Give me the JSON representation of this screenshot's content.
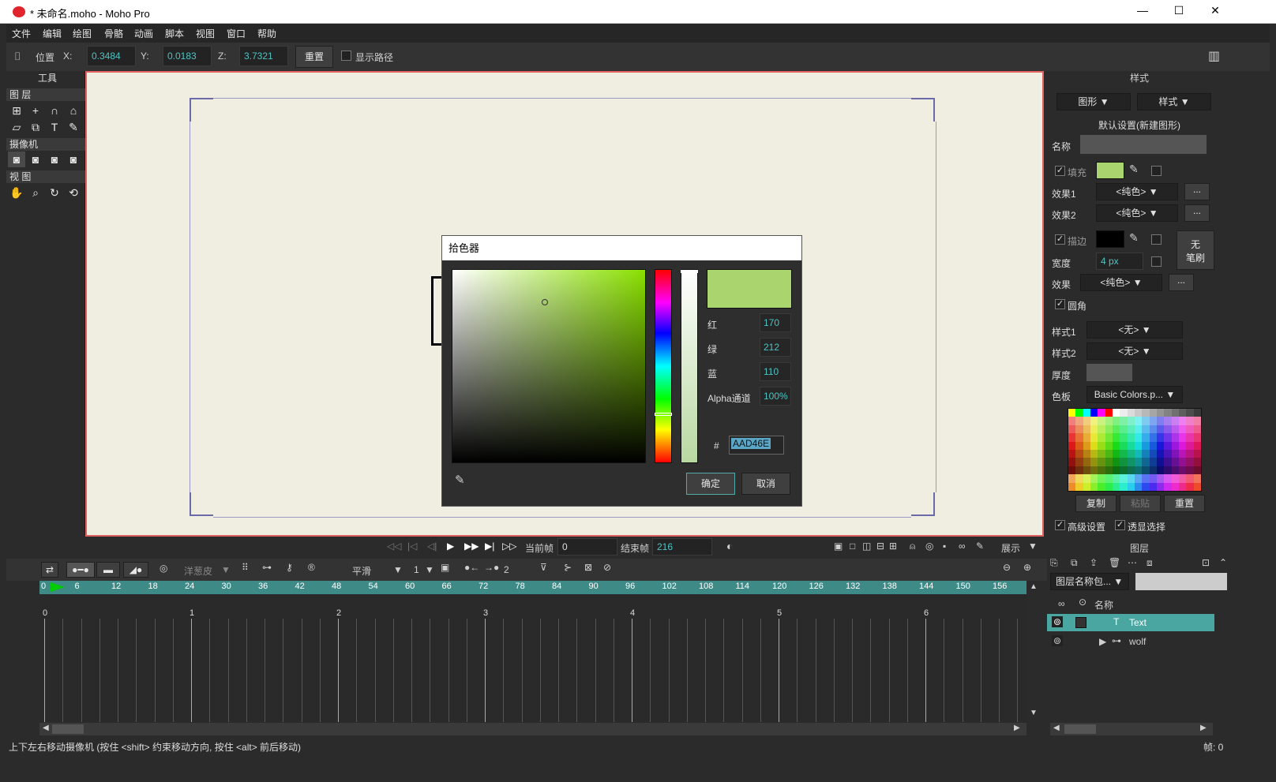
{
  "window": {
    "title": "* 未命名.moho - Moho Pro",
    "min": "—",
    "max": "☐",
    "close": "✕"
  },
  "menu": [
    "文件",
    "编辑",
    "绘图",
    "骨骼",
    "动画",
    "脚本",
    "视图",
    "窗口",
    "帮助"
  ],
  "options": {
    "position_label": "位置",
    "x_label": "X:",
    "x_value": "0.3484",
    "y_label": "Y:",
    "y_value": "0.0183",
    "z_label": "Z:",
    "z_value": "3.7321",
    "reset_label": "重置",
    "show_path_label": "显示路径"
  },
  "tools": {
    "header": "工具",
    "sections": {
      "layer": "图 层",
      "camera": "摄像机",
      "view": "视 图"
    },
    "icons": [
      "rect-select-icon",
      "add-point-icon",
      "curve-icon",
      "transform-icon",
      "shear-icon",
      "copy-icon",
      "text-icon",
      "brush-icon"
    ]
  },
  "color_picker": {
    "title": "拾色器",
    "red_label": "红",
    "red": "170",
    "green_label": "绿",
    "green": "212",
    "blue_label": "蓝",
    "blue": "110",
    "alpha_label": "Alpha通道",
    "alpha": "100%",
    "hash": "#",
    "hex": "AAD46E",
    "ok": "确定",
    "cancel": "取消",
    "color": "#aad46e"
  },
  "style_panel": {
    "header": "样式",
    "dd_shape": "图形",
    "dd_style": "样式",
    "defaults": "默认设置(新建图形)",
    "name_label": "名称",
    "fill_label": "填充",
    "fill_color": "#aad46e",
    "effect1_label": "效果1",
    "effect1": "<纯色>",
    "effect2_label": "效果2",
    "effect2": "<纯色>",
    "stroke_label": "描边",
    "stroke_color": "#000000",
    "no_brush": "无\n笔刷",
    "width_label": "宽度",
    "width_value": "4 px",
    "effect_label": "效果",
    "effect_value": "<纯色>",
    "round_label": "圆角",
    "style1_label": "样式1",
    "style1": "<无>",
    "style2_label": "样式2",
    "style2": "<无>",
    "thickness_label": "厚度",
    "palette_label": "色板",
    "palette": "Basic Colors.p...",
    "copy": "复制",
    "paste": "粘贴",
    "reset": "重置",
    "advanced": "高级设置",
    "see_through": "透显选择",
    "more": "..."
  },
  "playbar": {
    "current_frame_label": "当前帧",
    "current_frame": "0",
    "end_frame_label": "结束帧",
    "end_frame": "216",
    "display": "展示"
  },
  "timeline": {
    "onion": "洋葱皮",
    "smooth": "平滑",
    "one": "1",
    "two": "2",
    "frame_ticks": [
      "0",
      "6",
      "12",
      "18",
      "24",
      "30",
      "36",
      "42",
      "48",
      "54",
      "60",
      "66",
      "72",
      "78",
      "84",
      "90",
      "96",
      "102",
      "108",
      "114",
      "120",
      "126",
      "132",
      "138",
      "144",
      "150",
      "156"
    ],
    "seconds": [
      "0",
      "1",
      "2",
      "3",
      "4",
      "5",
      "6"
    ]
  },
  "layers": {
    "header": "图层",
    "sort": "图层名称包...",
    "name_col": "名称",
    "items": [
      {
        "name": "Text",
        "selected": true
      },
      {
        "name": "wolf",
        "selected": false
      }
    ]
  },
  "status": {
    "message": "上下左右移动摄像机 (按住 <shift> 约束移动方向, 按住 <alt> 前后移动)",
    "frame": "帧: 0"
  }
}
